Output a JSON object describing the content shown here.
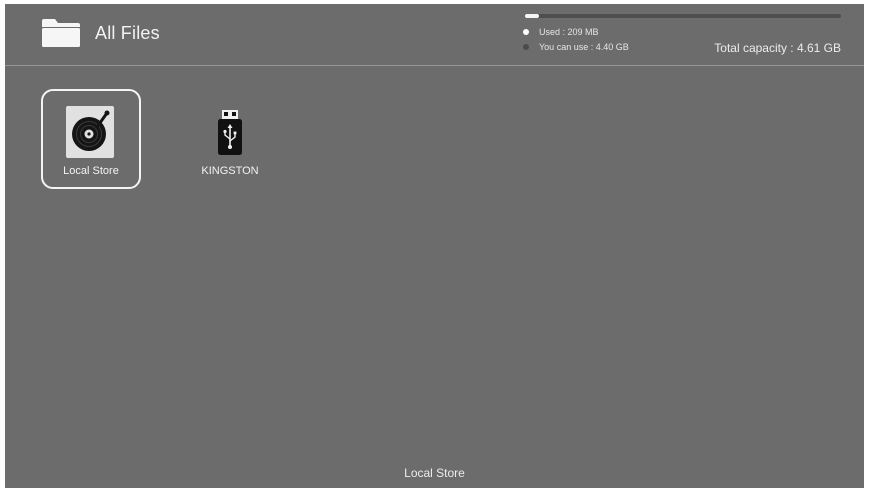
{
  "header": {
    "title": "All Files",
    "storage": {
      "used_label": "Used : 209 MB",
      "available_label": "You can use : 4.40 GB",
      "total_label": "Total capacity : 4.61 GB",
      "used_fraction": 0.045
    }
  },
  "items": [
    {
      "label": "Local Store",
      "icon": "disc-icon",
      "selected": true
    },
    {
      "label": "KINGSTON",
      "icon": "usb-drive-icon",
      "selected": false
    }
  ],
  "footer": {
    "label": "Local Store"
  },
  "colors": {
    "background": "#6c6c6c",
    "text": "#f2f2f2",
    "focus_border": "#f4f4f4"
  }
}
